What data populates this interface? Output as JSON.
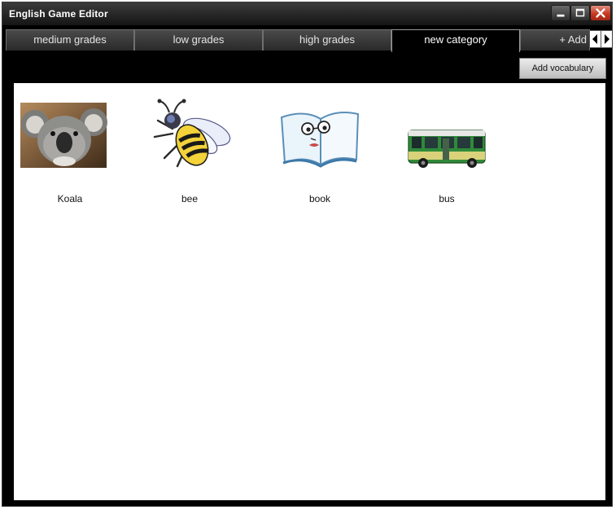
{
  "window": {
    "title": "English Game Editor"
  },
  "tabs": [
    {
      "label": "medium grades"
    },
    {
      "label": "low grades"
    },
    {
      "label": "high grades"
    },
    {
      "label": "new category"
    },
    {
      "label": "+ Add"
    }
  ],
  "toolbar": {
    "add_vocabulary_label": "Add vocabulary"
  },
  "vocabulary": [
    {
      "label": "Koala"
    },
    {
      "label": "bee"
    },
    {
      "label": "book"
    },
    {
      "label": "bus"
    }
  ],
  "colors": {
    "accent_close": "#c73a22",
    "tab_active_bg": "#000000",
    "background": "#000000",
    "canvas": "#ffffff"
  }
}
